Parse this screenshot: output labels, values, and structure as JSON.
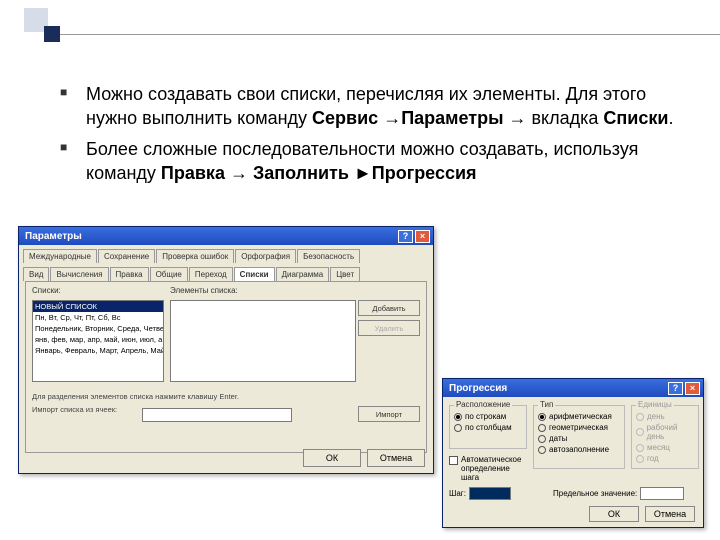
{
  "bullets": {
    "b1_p1": "Можно создавать свои списки, перечисляя их элементы. Для этого нужно выполнить команду ",
    "b1_s1": "Сервис",
    "b1_arr1": " →",
    "b1_s2": "Параметры",
    "b1_arr2": " → вкладка ",
    "b1_s3": "Списки",
    "b1_dot": ".",
    "b2_p1": "Более сложные последовательности можно создавать, используя команду ",
    "b2_s1": "Правка",
    "b2_arr1": " → ",
    "b2_s2": "Заполнить",
    "b2_tri": " ►",
    "b2_s3": "Прогрессия"
  },
  "win1": {
    "title": "Параметры",
    "help": "?",
    "close": "×",
    "tabs_row1": [
      "Международные",
      "Сохранение",
      "Проверка ошибок",
      "Орфография",
      "Безопасность"
    ],
    "tabs_row2": [
      "Вид",
      "Вычисления",
      "Правка",
      "Общие",
      "Переход",
      "Списки",
      "Диаграмма",
      "Цвет"
    ],
    "active_tab": "Списки",
    "grp_lists": "Списки:",
    "grp_elements": "Элементы списка:",
    "list_items": [
      "НОВЫЙ СПИСОК",
      "Пн, Вт, Ср, Чт, Пт, Сб, Вс",
      "Понедельник, Вторник, Среда, Четверг",
      "янв, фев, мар, апр, май, июн, июл, а",
      "Январь, Февраль, Март, Апрель, Май, И"
    ],
    "btn_add": "Добавить",
    "btn_del": "Удалить",
    "hint1": "Для разделения элементов списка нажмите клавишу Enter.",
    "hint2": "Импорт списка из ячеек:",
    "btn_import": "Импорт",
    "ok": "ОК",
    "cancel": "Отмена"
  },
  "win2": {
    "title": "Прогрессия",
    "help": "?",
    "close": "×",
    "grp_loc": "Расположение",
    "loc_rows": "по строкам",
    "loc_cols": "по столбцам",
    "grp_type": "Тип",
    "type_arith": "арифметическая",
    "type_geom": "геометрическая",
    "type_dates": "даты",
    "type_auto": "автозаполнение",
    "grp_units": "Единицы",
    "unit_day": "день",
    "unit_wday": "рабочий день",
    "unit_month": "месяц",
    "unit_year": "год",
    "chk_auto": "Автоматическое определение шага",
    "lbl_step": "Шаг:",
    "lbl_limit": "Предельное значение:",
    "ok": "ОК",
    "cancel": "Отмена"
  }
}
